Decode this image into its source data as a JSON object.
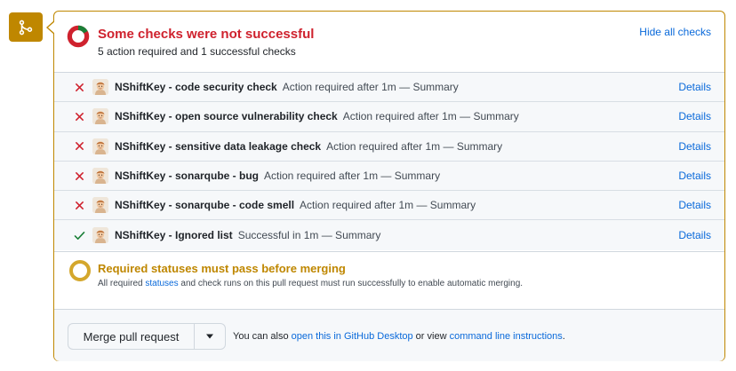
{
  "summary": {
    "title": "Some checks were not successful",
    "subtitle": "5 action required and 1 successful checks",
    "hide_label": "Hide all checks",
    "donut": {
      "failed": 5,
      "passed": 1,
      "fail_color": "#cf222e",
      "pass_color": "#1a7f37"
    }
  },
  "checks": [
    {
      "status": "failed",
      "icon": "x-icon",
      "name": "NShiftKey - code security check",
      "description": "Action required after 1m — Summary",
      "link": "Details"
    },
    {
      "status": "failed",
      "icon": "x-icon",
      "name": "NShiftKey - open source vulnerability check",
      "description": "Action required after 1m — Summary",
      "link": "Details"
    },
    {
      "status": "failed",
      "icon": "x-icon",
      "name": "NShiftKey - sensitive data leakage check",
      "description": "Action required after 1m — Summary",
      "link": "Details"
    },
    {
      "status": "failed",
      "icon": "x-icon",
      "name": "NShiftKey - sonarqube - bug",
      "description": "Action required after 1m — Summary",
      "link": "Details"
    },
    {
      "status": "failed",
      "icon": "x-icon",
      "name": "NShiftKey - sonarqube - code smell",
      "description": "Action required after 1m — Summary",
      "link": "Details"
    },
    {
      "status": "success",
      "icon": "check-icon",
      "name": "NShiftKey - Ignored list",
      "description": "Successful in 1m — Summary",
      "link": "Details"
    }
  ],
  "required": {
    "title": "Required statuses must pass before merging",
    "desc_before": "All required ",
    "desc_link": "statuses",
    "desc_after": " and check runs on this pull request must run successfully to enable automatic merging."
  },
  "merge": {
    "button_label": "Merge pull request",
    "note_before": "You can also ",
    "note_link1": "open this in GitHub Desktop",
    "note_middle": " or view ",
    "note_link2": "command line instructions",
    "note_after": "."
  },
  "colors": {
    "accent_warning": "#bf8700",
    "danger": "#cf222e",
    "success": "#1a7f37",
    "link": "#0969da"
  }
}
